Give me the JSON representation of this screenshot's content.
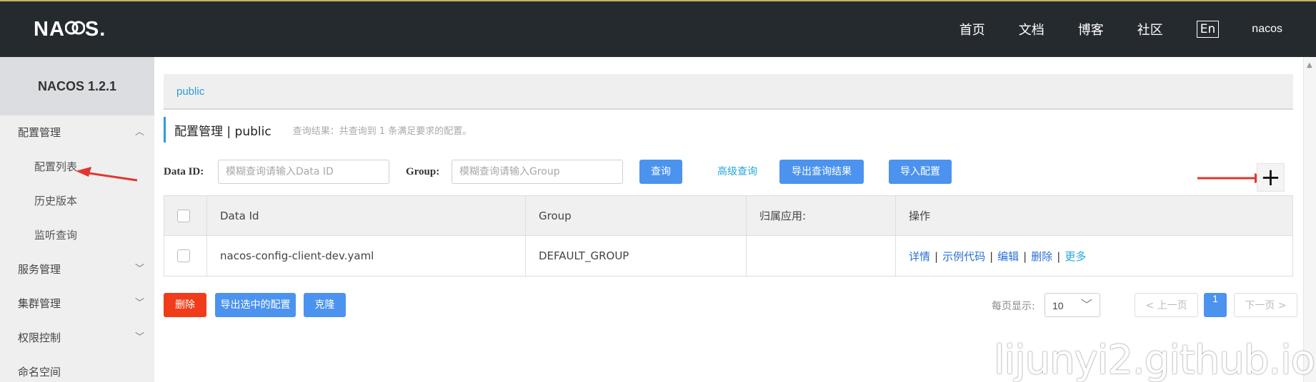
{
  "topbar": {
    "logo": {
      "pre": "NA",
      "post": "S."
    },
    "nav": [
      "首页",
      "文档",
      "博客",
      "社区"
    ],
    "lang": "En",
    "user": "nacos"
  },
  "sidebar": {
    "version": "NACOS 1.2.1",
    "items": [
      {
        "label": "配置管理",
        "icon": "chevron-up-icon"
      },
      {
        "label": "配置列表"
      },
      {
        "label": "历史版本"
      },
      {
        "label": "监听查询"
      },
      {
        "label": "服务管理",
        "icon": "chevron-down-icon"
      },
      {
        "label": "集群管理",
        "icon": "chevron-down-icon"
      },
      {
        "label": "权限控制",
        "icon": "chevron-down-icon"
      },
      {
        "label": "命名空间"
      }
    ]
  },
  "breadcrumb": "public",
  "title": {
    "text": "配置管理 | public",
    "hint": "查询结果：共查询到 1 条满足要求的配置。"
  },
  "filters": {
    "dataid_label": "Data ID:",
    "dataid_placeholder": "模糊查询请输入Data ID",
    "group_label": "Group:",
    "group_placeholder": "模糊查询请输入Group",
    "query": "查询",
    "advanced": "高级查询",
    "export": "导出查询结果",
    "import": "导入配置",
    "add_icon": "plus-icon"
  },
  "table": {
    "headers": [
      "Data Id",
      "Group",
      "归属应用:",
      "操作"
    ],
    "rows": [
      {
        "dataid": "nacos-config-client-dev.yaml",
        "group": "DEFAULT_GROUP",
        "app": "",
        "actions": [
          "详情",
          "示例代码",
          "编辑",
          "删除",
          "更多"
        ]
      }
    ]
  },
  "bottom": {
    "delete": "删除",
    "export_selected": "导出选中的配置",
    "clone": "克隆",
    "per_page_label": "每页显示:",
    "per_page": "10",
    "prev": "< 上一页",
    "current": "1",
    "next": "下一页 >"
  },
  "watermark": "lijunyi2.github.io",
  "colors": {
    "accent": "#4b93ef",
    "link": "#23a7d9",
    "danger": "#f03c1a",
    "topbar": "#252a2f"
  }
}
